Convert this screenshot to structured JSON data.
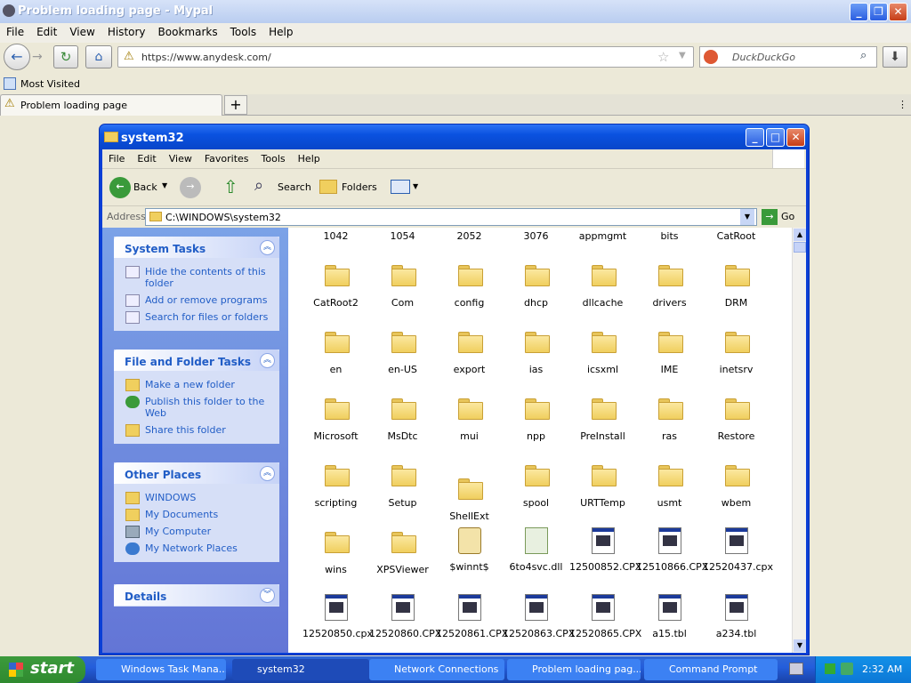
{
  "browser": {
    "title": "Problem loading page - Mypal",
    "menu": [
      "File",
      "Edit",
      "View",
      "History",
      "Bookmarks",
      "Tools",
      "Help"
    ],
    "url": "https://www.anydesk.com/",
    "search_placeholder": "DuckDuckGo",
    "bookmark": "Most Visited",
    "tab": "Problem loading page",
    "tab_add": "+"
  },
  "explorer": {
    "title": "system32",
    "menu": [
      "File",
      "Edit",
      "View",
      "Favorites",
      "Tools",
      "Help"
    ],
    "toolbar": {
      "back": "Back",
      "search": "Search",
      "folders": "Folders"
    },
    "address_label": "Address",
    "address": "C:\\WINDOWS\\system32",
    "go": "Go",
    "panels": [
      {
        "title": "System Tasks",
        "items": [
          "Hide the contents of this folder",
          "Add or remove programs",
          "Search for files or folders"
        ]
      },
      {
        "title": "File and Folder Tasks",
        "items": [
          "Make a new folder",
          "Publish this folder to the Web",
          "Share this folder"
        ]
      },
      {
        "title": "Other Places",
        "items": [
          "WINDOWS",
          "My Documents",
          "My Computer",
          "My Network Places"
        ]
      },
      {
        "title": "Details",
        "items": []
      }
    ],
    "top_row": [
      "1042",
      "1054",
      "2052",
      "3076",
      "appmgmt",
      "bits",
      "CatRoot"
    ],
    "rows": [
      [
        "CatRoot2",
        "Com",
        "config",
        "dhcp",
        "dllcache",
        "drivers",
        "DRM"
      ],
      [
        "en",
        "en-US",
        "export",
        "ias",
        "icsxml",
        "IME",
        "inetsrv"
      ],
      [
        "Microsoft",
        "MsDtc",
        "mui",
        "npp",
        "PreInstall",
        "ras",
        "Restore"
      ],
      [
        "scripting",
        "Setup",
        "ShellExt",
        "spool",
        "URTTemp",
        "usmt",
        "wbem"
      ],
      [
        "wins",
        "XPSViewer",
        "$winnt$",
        "6to4svc.dll",
        "12500852.CPX",
        "12510866.CPX",
        "12520437.cpx"
      ],
      [
        "12520850.cpx",
        "12520860.CPX",
        "12520861.CPX",
        "12520863.CPX",
        "12520865.CPX",
        "a15.tbl",
        "a234.tbl"
      ]
    ]
  },
  "taskbar": {
    "start": "start",
    "tasks": [
      "Windows Task Mana...",
      "system32",
      "Network Connections",
      "Problem loading pag...",
      "Command Prompt"
    ],
    "time": "2:32 AM"
  }
}
